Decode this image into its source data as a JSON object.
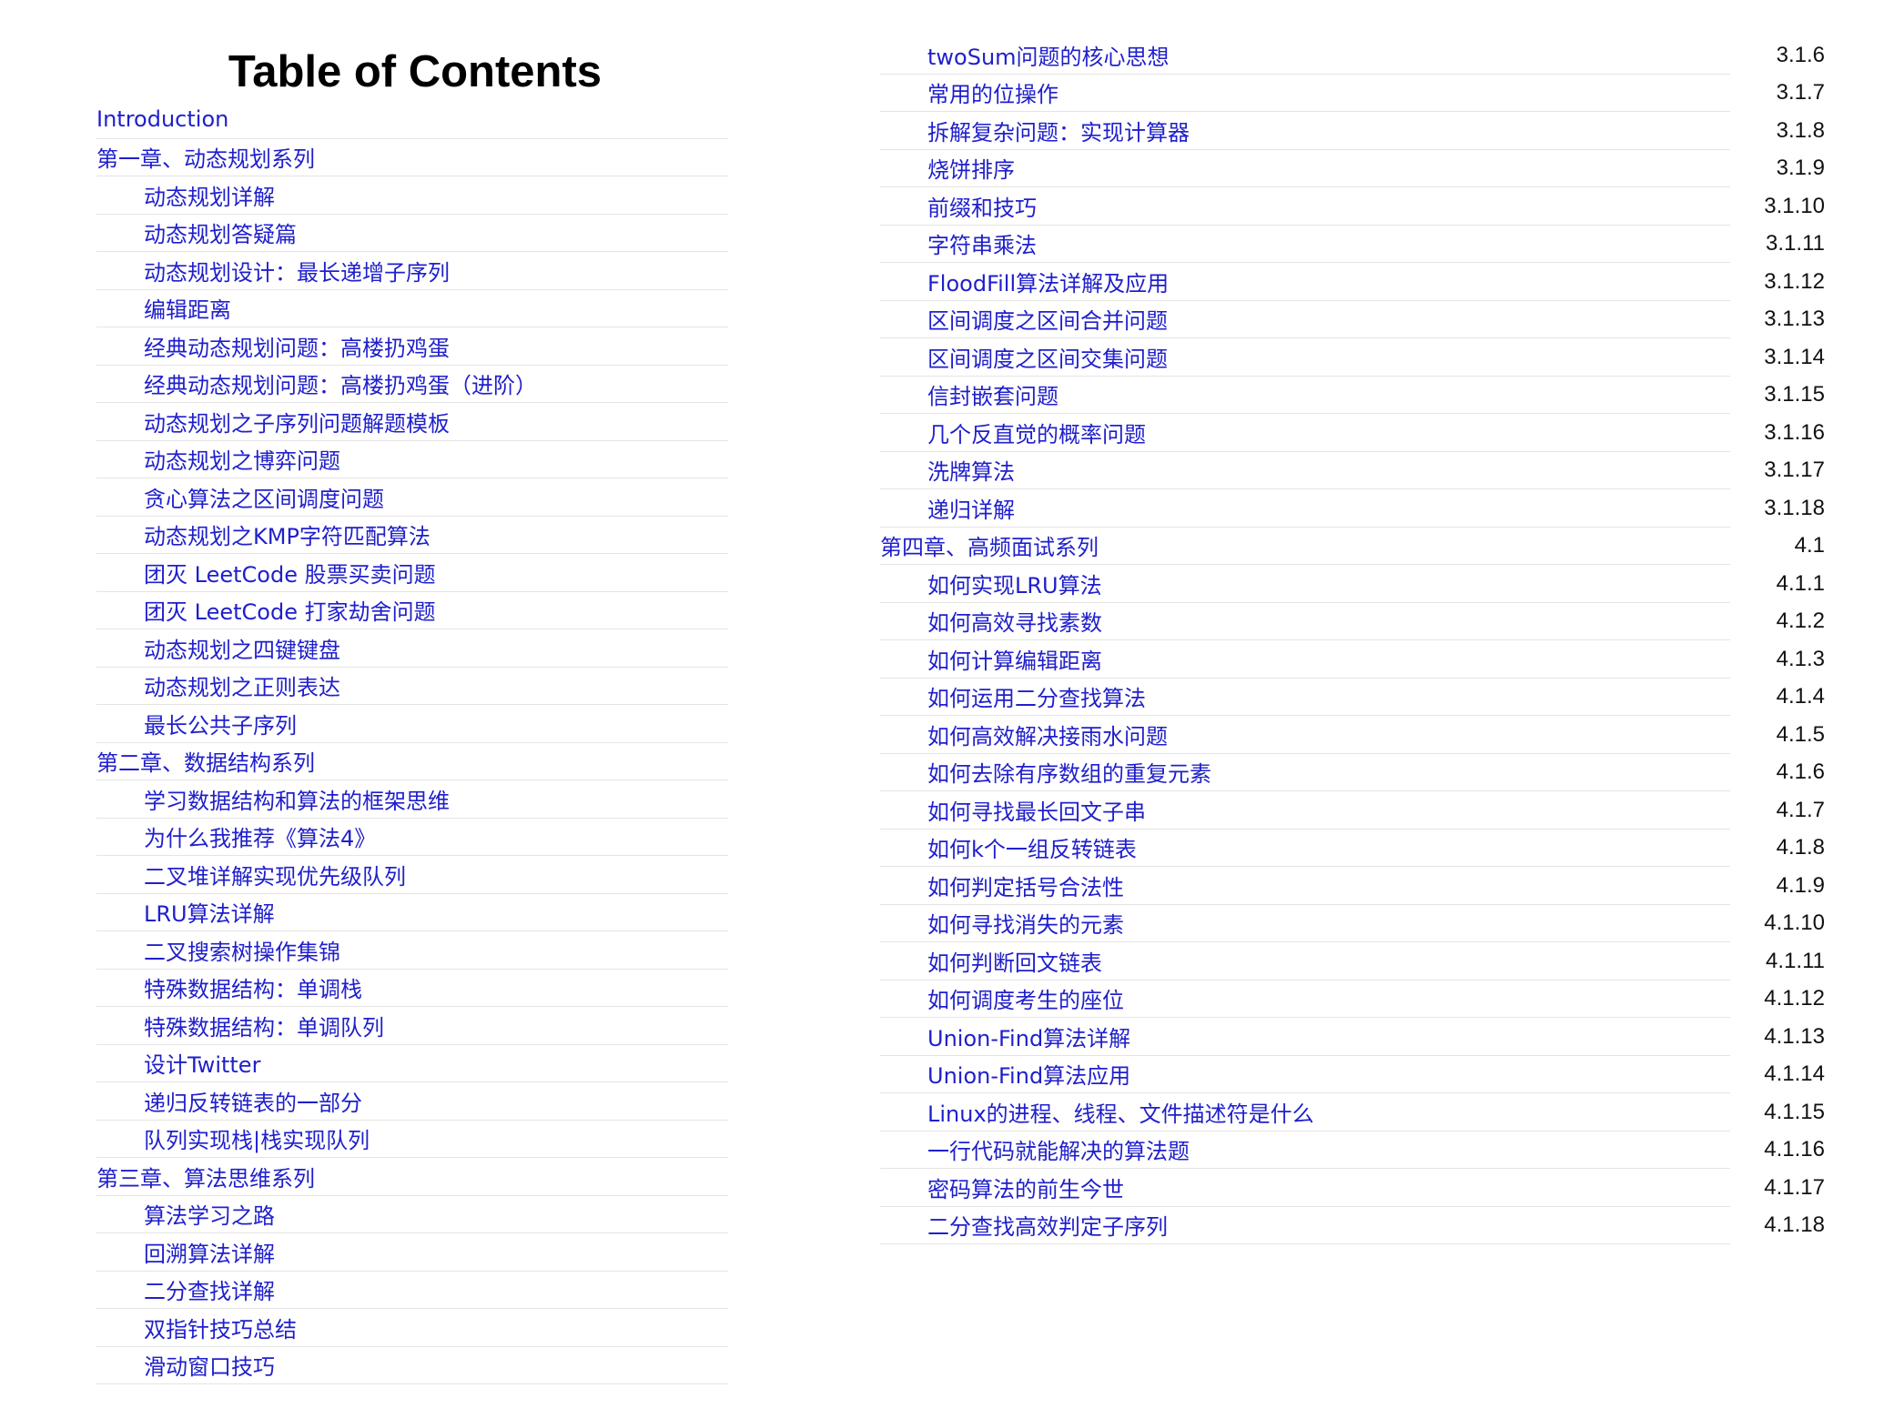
{
  "title": "Table of Contents",
  "left_entries": [
    {
      "text": "Introduction",
      "level": 0
    },
    {
      "text": "第一章、动态规划系列",
      "level": 0
    },
    {
      "text": "动态规划详解",
      "level": 1
    },
    {
      "text": "动态规划答疑篇",
      "level": 1
    },
    {
      "text": "动态规划设计：最长递增子序列",
      "level": 1
    },
    {
      "text": "编辑距离",
      "level": 1
    },
    {
      "text": "经典动态规划问题：高楼扔鸡蛋",
      "level": 1
    },
    {
      "text": "经典动态规划问题：高楼扔鸡蛋（进阶）",
      "level": 1
    },
    {
      "text": "动态规划之子序列问题解题模板",
      "level": 1
    },
    {
      "text": "动态规划之博弈问题",
      "level": 1
    },
    {
      "text": "贪心算法之区间调度问题",
      "level": 1
    },
    {
      "text": "动态规划之KMP字符匹配算法",
      "level": 1
    },
    {
      "text": "团灭 LeetCode 股票买卖问题",
      "level": 1
    },
    {
      "text": "团灭 LeetCode 打家劫舍问题",
      "level": 1
    },
    {
      "text": "动态规划之四键键盘",
      "level": 1
    },
    {
      "text": "动态规划之正则表达",
      "level": 1
    },
    {
      "text": "最长公共子序列",
      "level": 1
    },
    {
      "text": "第二章、数据结构系列",
      "level": 0
    },
    {
      "text": "学习数据结构和算法的框架思维",
      "level": 1
    },
    {
      "text": "为什么我推荐《算法4》",
      "level": 1
    },
    {
      "text": "二叉堆详解实现优先级队列",
      "level": 1
    },
    {
      "text": "LRU算法详解",
      "level": 1
    },
    {
      "text": "二叉搜索树操作集锦",
      "level": 1
    },
    {
      "text": "特殊数据结构：单调栈",
      "level": 1
    },
    {
      "text": "特殊数据结构：单调队列",
      "level": 1
    },
    {
      "text": "设计Twitter",
      "level": 1
    },
    {
      "text": "递归反转链表的一部分",
      "level": 1
    },
    {
      "text": "队列实现栈|栈实现队列",
      "level": 1
    },
    {
      "text": "第三章、算法思维系列",
      "level": 0
    },
    {
      "text": "算法学习之路",
      "level": 1
    },
    {
      "text": "回溯算法详解",
      "level": 1
    },
    {
      "text": "二分查找详解",
      "level": 1
    },
    {
      "text": "双指针技巧总结",
      "level": 1
    },
    {
      "text": "滑动窗口技巧",
      "level": 1
    }
  ],
  "right_entries": [
    {
      "text": "twoSum问题的核心思想",
      "num": "3.1.6",
      "level": 1
    },
    {
      "text": "常用的位操作",
      "num": "3.1.7",
      "level": 1
    },
    {
      "text": "拆解复杂问题：实现计算器",
      "num": "3.1.8",
      "level": 1
    },
    {
      "text": "烧饼排序",
      "num": "3.1.9",
      "level": 1
    },
    {
      "text": "前缀和技巧",
      "num": "3.1.10",
      "level": 1
    },
    {
      "text": "字符串乘法",
      "num": "3.1.11",
      "level": 1
    },
    {
      "text": "FloodFill算法详解及应用",
      "num": "3.1.12",
      "level": 1
    },
    {
      "text": "区间调度之区间合并问题",
      "num": "3.1.13",
      "level": 1
    },
    {
      "text": "区间调度之区间交集问题",
      "num": "3.1.14",
      "level": 1
    },
    {
      "text": "信封嵌套问题",
      "num": "3.1.15",
      "level": 1
    },
    {
      "text": "几个反直觉的概率问题",
      "num": "3.1.16",
      "level": 1
    },
    {
      "text": "洗牌算法",
      "num": "3.1.17",
      "level": 1
    },
    {
      "text": "递归详解",
      "num": "3.1.18",
      "level": 1
    },
    {
      "text": "第四章、高频面试系列",
      "num": "4.1",
      "level": 0
    },
    {
      "text": "如何实现LRU算法",
      "num": "4.1.1",
      "level": 1
    },
    {
      "text": "如何高效寻找素数",
      "num": "4.1.2",
      "level": 1
    },
    {
      "text": "如何计算编辑距离",
      "num": "4.1.3",
      "level": 1
    },
    {
      "text": "如何运用二分查找算法",
      "num": "4.1.4",
      "level": 1
    },
    {
      "text": "如何高效解决接雨水问题",
      "num": "4.1.5",
      "level": 1
    },
    {
      "text": "如何去除有序数组的重复元素",
      "num": "4.1.6",
      "level": 1
    },
    {
      "text": "如何寻找最长回文子串",
      "num": "4.1.7",
      "level": 1
    },
    {
      "text": "如何k个一组反转链表",
      "num": "4.1.8",
      "level": 1
    },
    {
      "text": "如何判定括号合法性",
      "num": "4.1.9",
      "level": 1
    },
    {
      "text": "如何寻找消失的元素",
      "num": "4.1.10",
      "level": 1
    },
    {
      "text": "如何判断回文链表",
      "num": "4.1.11",
      "level": 1
    },
    {
      "text": "如何调度考生的座位",
      "num": "4.1.12",
      "level": 1
    },
    {
      "text": "Union-Find算法详解",
      "num": "4.1.13",
      "level": 1
    },
    {
      "text": "Union-Find算法应用",
      "num": "4.1.14",
      "level": 1
    },
    {
      "text": "Linux的进程、线程、文件描述符是什么",
      "num": "4.1.15",
      "level": 1
    },
    {
      "text": "一行代码就能解决的算法题",
      "num": "4.1.16",
      "level": 1
    },
    {
      "text": "密码算法的前生今世",
      "num": "4.1.17",
      "level": 1
    },
    {
      "text": "二分查找高效判定子序列",
      "num": "4.1.18",
      "level": 1
    }
  ]
}
